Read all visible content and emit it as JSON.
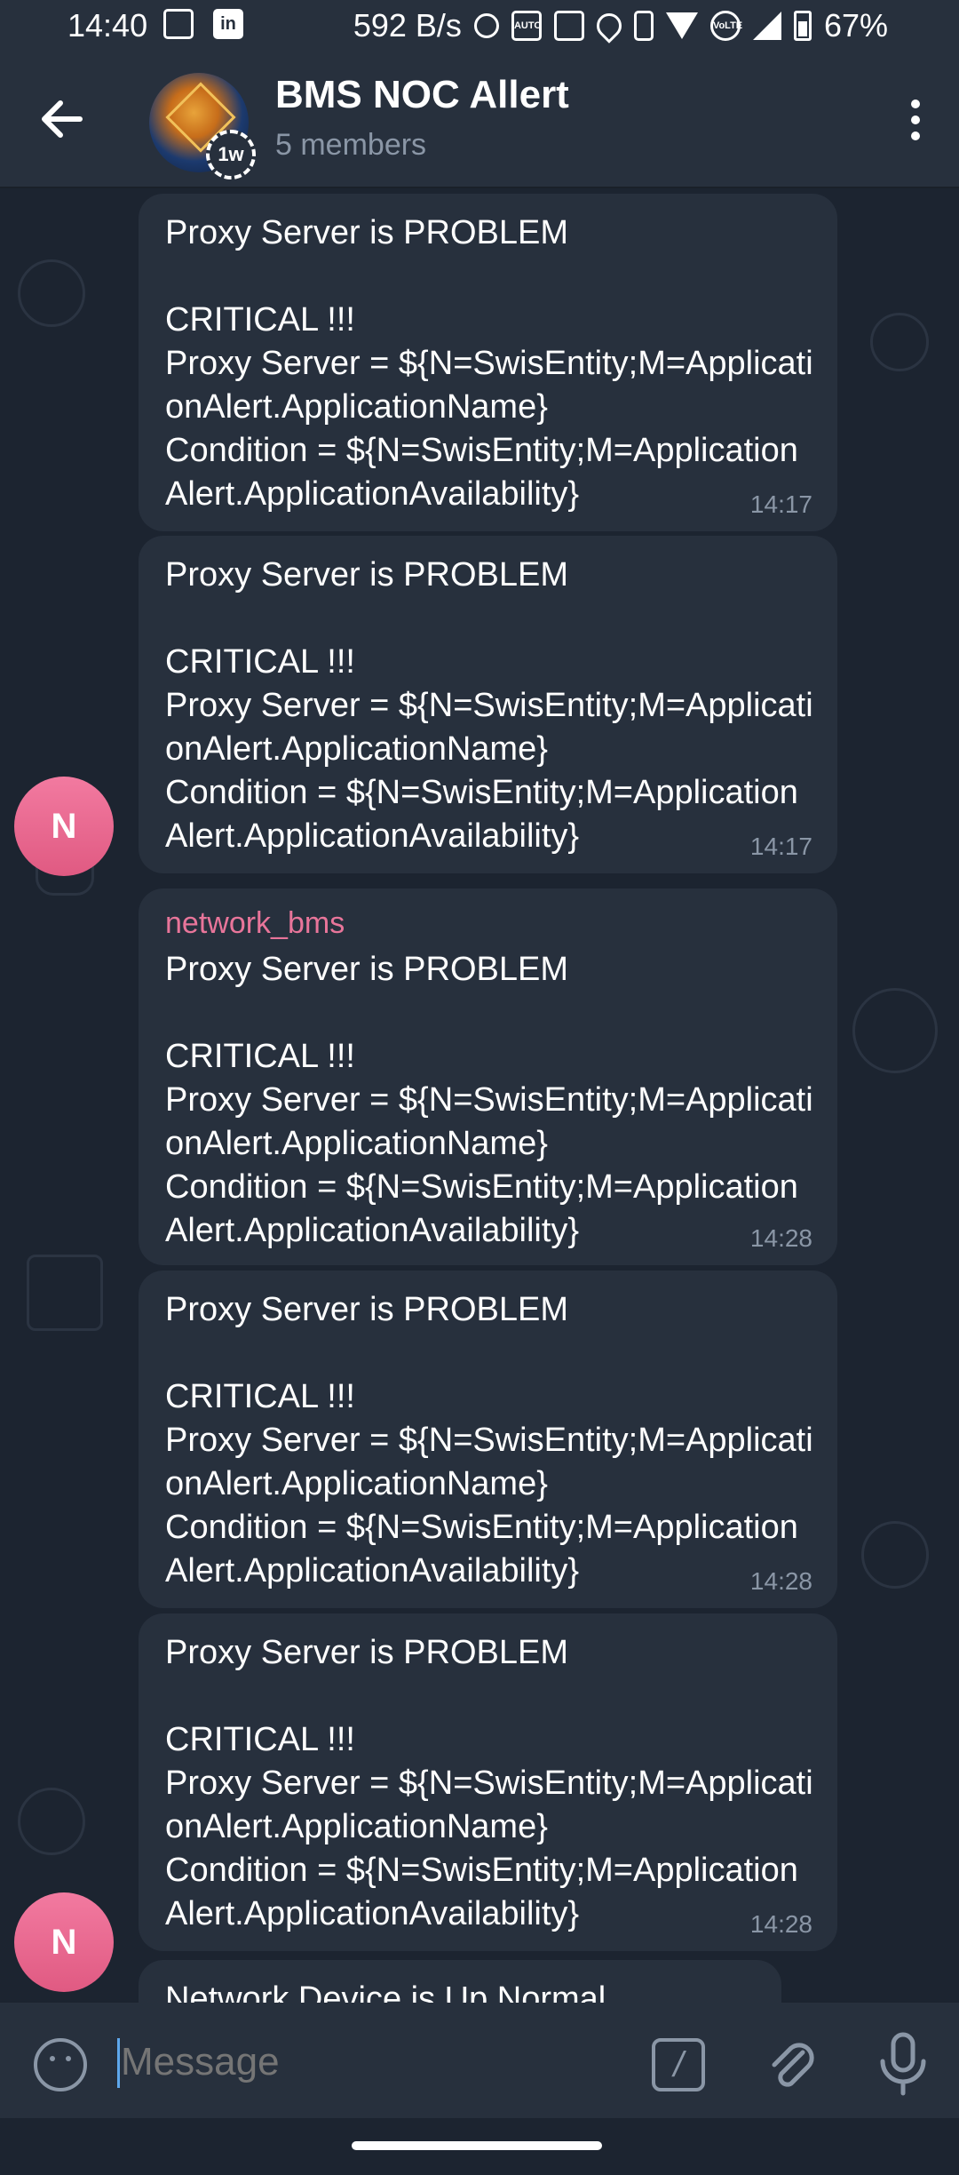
{
  "status_bar": {
    "time": "14:40",
    "network_speed": "592 B/s",
    "battery": "67%",
    "icons": [
      "gallery-icon",
      "linkedin-icon",
      "alarm-icon",
      "auto-icon",
      "nfc-icon",
      "location-icon",
      "vibrate-icon",
      "wifi-icon",
      "volte-icon",
      "signal-icon",
      "battery-icon"
    ]
  },
  "header": {
    "title": "BMS NOC Allert",
    "subtitle": "5 members",
    "avatar_badge": "1w"
  },
  "messages": [
    {
      "sender": "",
      "lines": "Proxy Server is PROBLEM\n\nCRITICAL !!!\nProxy Server = ${N=SwisEntity;M=ApplicationAlert.ApplicationName}\nCondition = ${N=SwisEntity;M=ApplicationAlert.ApplicationAvailability}",
      "time": "14:17"
    },
    {
      "sender": "",
      "lines": "Proxy Server is PROBLEM\n\nCRITICAL !!!\nProxy Server = ${N=SwisEntity;M=ApplicationAlert.ApplicationName}\nCondition = ${N=SwisEntity;M=ApplicationAlert.ApplicationAvailability}",
      "time": "14:17"
    },
    {
      "sender": "network_bms",
      "lines": "Proxy Server is PROBLEM\n\nCRITICAL !!!\nProxy Server = ${N=SwisEntity;M=ApplicationAlert.ApplicationName}\nCondition = ${N=SwisEntity;M=ApplicationAlert.ApplicationAvailability}",
      "time": "14:28"
    },
    {
      "sender": "",
      "lines": "Proxy Server is PROBLEM\n\nCRITICAL !!!\nProxy Server = ${N=SwisEntity;M=ApplicationAlert.ApplicationName}\nCondition = ${N=SwisEntity;M=ApplicationAlert.ApplicationAvailability}",
      "time": "14:28"
    },
    {
      "sender": "",
      "lines": "Proxy Server is PROBLEM\n\nCRITICAL !!!\nProxy Server = ${N=SwisEntity;M=ApplicationAlert.ApplicationName}\nCondition = ${N=SwisEntity;M=ApplicationAlert.ApplicationAvailability}",
      "time": "14:28"
    },
    {
      "sender": "",
      "lines": "Network Device is Up Normal",
      "time": ""
    }
  ],
  "user_avatar_initial": "N",
  "input": {
    "placeholder": "Message",
    "command_icon_label": "/"
  },
  "colors": {
    "background": "#1c2430",
    "bubble": "#27303d",
    "sender_name": "#e8759a",
    "avatar": "#f27aa0",
    "accent": "#5ea7ec"
  }
}
